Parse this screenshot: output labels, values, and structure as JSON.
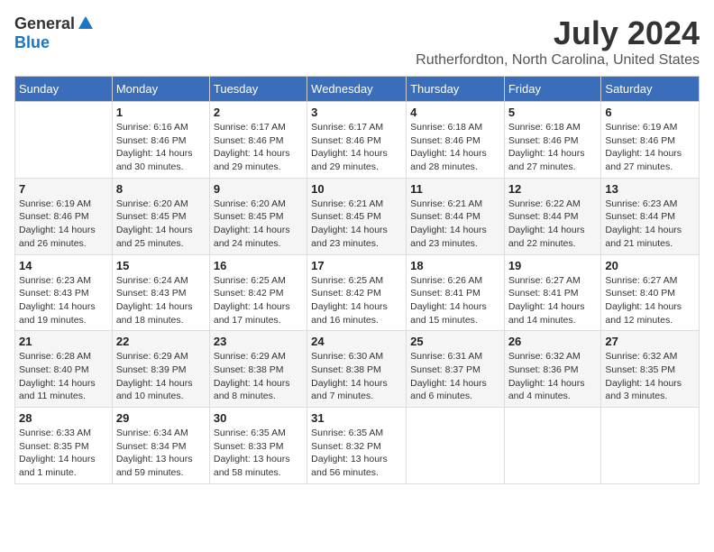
{
  "logo": {
    "general": "General",
    "blue": "Blue"
  },
  "title": {
    "month": "July 2024",
    "location": "Rutherfordton, North Carolina, United States"
  },
  "headers": [
    "Sunday",
    "Monday",
    "Tuesday",
    "Wednesday",
    "Thursday",
    "Friday",
    "Saturday"
  ],
  "weeks": [
    [
      {
        "day": "",
        "info": ""
      },
      {
        "day": "1",
        "info": "Sunrise: 6:16 AM\nSunset: 8:46 PM\nDaylight: 14 hours\nand 30 minutes."
      },
      {
        "day": "2",
        "info": "Sunrise: 6:17 AM\nSunset: 8:46 PM\nDaylight: 14 hours\nand 29 minutes."
      },
      {
        "day": "3",
        "info": "Sunrise: 6:17 AM\nSunset: 8:46 PM\nDaylight: 14 hours\nand 29 minutes."
      },
      {
        "day": "4",
        "info": "Sunrise: 6:18 AM\nSunset: 8:46 PM\nDaylight: 14 hours\nand 28 minutes."
      },
      {
        "day": "5",
        "info": "Sunrise: 6:18 AM\nSunset: 8:46 PM\nDaylight: 14 hours\nand 27 minutes."
      },
      {
        "day": "6",
        "info": "Sunrise: 6:19 AM\nSunset: 8:46 PM\nDaylight: 14 hours\nand 27 minutes."
      }
    ],
    [
      {
        "day": "7",
        "info": "Sunrise: 6:19 AM\nSunset: 8:46 PM\nDaylight: 14 hours\nand 26 minutes."
      },
      {
        "day": "8",
        "info": "Sunrise: 6:20 AM\nSunset: 8:45 PM\nDaylight: 14 hours\nand 25 minutes."
      },
      {
        "day": "9",
        "info": "Sunrise: 6:20 AM\nSunset: 8:45 PM\nDaylight: 14 hours\nand 24 minutes."
      },
      {
        "day": "10",
        "info": "Sunrise: 6:21 AM\nSunset: 8:45 PM\nDaylight: 14 hours\nand 23 minutes."
      },
      {
        "day": "11",
        "info": "Sunrise: 6:21 AM\nSunset: 8:44 PM\nDaylight: 14 hours\nand 23 minutes."
      },
      {
        "day": "12",
        "info": "Sunrise: 6:22 AM\nSunset: 8:44 PM\nDaylight: 14 hours\nand 22 minutes."
      },
      {
        "day": "13",
        "info": "Sunrise: 6:23 AM\nSunset: 8:44 PM\nDaylight: 14 hours\nand 21 minutes."
      }
    ],
    [
      {
        "day": "14",
        "info": "Sunrise: 6:23 AM\nSunset: 8:43 PM\nDaylight: 14 hours\nand 19 minutes."
      },
      {
        "day": "15",
        "info": "Sunrise: 6:24 AM\nSunset: 8:43 PM\nDaylight: 14 hours\nand 18 minutes."
      },
      {
        "day": "16",
        "info": "Sunrise: 6:25 AM\nSunset: 8:42 PM\nDaylight: 14 hours\nand 17 minutes."
      },
      {
        "day": "17",
        "info": "Sunrise: 6:25 AM\nSunset: 8:42 PM\nDaylight: 14 hours\nand 16 minutes."
      },
      {
        "day": "18",
        "info": "Sunrise: 6:26 AM\nSunset: 8:41 PM\nDaylight: 14 hours\nand 15 minutes."
      },
      {
        "day": "19",
        "info": "Sunrise: 6:27 AM\nSunset: 8:41 PM\nDaylight: 14 hours\nand 14 minutes."
      },
      {
        "day": "20",
        "info": "Sunrise: 6:27 AM\nSunset: 8:40 PM\nDaylight: 14 hours\nand 12 minutes."
      }
    ],
    [
      {
        "day": "21",
        "info": "Sunrise: 6:28 AM\nSunset: 8:40 PM\nDaylight: 14 hours\nand 11 minutes."
      },
      {
        "day": "22",
        "info": "Sunrise: 6:29 AM\nSunset: 8:39 PM\nDaylight: 14 hours\nand 10 minutes."
      },
      {
        "day": "23",
        "info": "Sunrise: 6:29 AM\nSunset: 8:38 PM\nDaylight: 14 hours\nand 8 minutes."
      },
      {
        "day": "24",
        "info": "Sunrise: 6:30 AM\nSunset: 8:38 PM\nDaylight: 14 hours\nand 7 minutes."
      },
      {
        "day": "25",
        "info": "Sunrise: 6:31 AM\nSunset: 8:37 PM\nDaylight: 14 hours\nand 6 minutes."
      },
      {
        "day": "26",
        "info": "Sunrise: 6:32 AM\nSunset: 8:36 PM\nDaylight: 14 hours\nand 4 minutes."
      },
      {
        "day": "27",
        "info": "Sunrise: 6:32 AM\nSunset: 8:35 PM\nDaylight: 14 hours\nand 3 minutes."
      }
    ],
    [
      {
        "day": "28",
        "info": "Sunrise: 6:33 AM\nSunset: 8:35 PM\nDaylight: 14 hours\nand 1 minute."
      },
      {
        "day": "29",
        "info": "Sunrise: 6:34 AM\nSunset: 8:34 PM\nDaylight: 13 hours\nand 59 minutes."
      },
      {
        "day": "30",
        "info": "Sunrise: 6:35 AM\nSunset: 8:33 PM\nDaylight: 13 hours\nand 58 minutes."
      },
      {
        "day": "31",
        "info": "Sunrise: 6:35 AM\nSunset: 8:32 PM\nDaylight: 13 hours\nand 56 minutes."
      },
      {
        "day": "",
        "info": ""
      },
      {
        "day": "",
        "info": ""
      },
      {
        "day": "",
        "info": ""
      }
    ]
  ]
}
